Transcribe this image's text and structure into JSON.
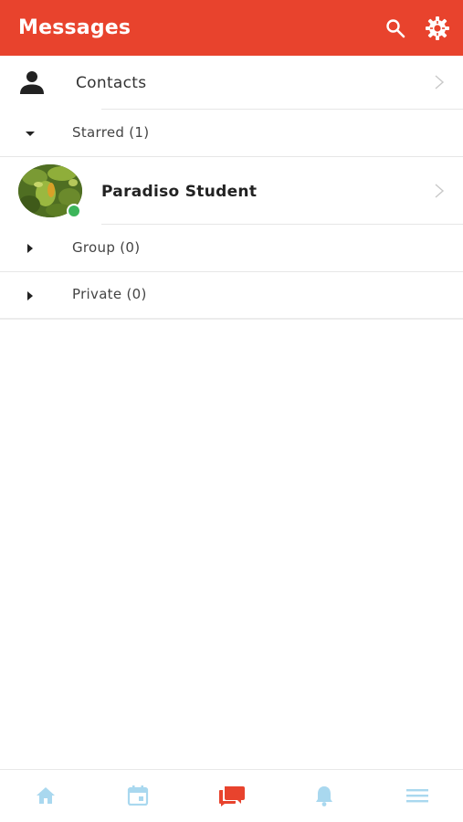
{
  "header": {
    "title": "Messages",
    "search_icon": "search-icon",
    "settings_icon": "gear-icon",
    "bg_color": "#e8432d"
  },
  "contacts": {
    "label": "Contacts",
    "icon": "person-icon"
  },
  "sections": {
    "starred": {
      "label": "Starred (1)",
      "expanded": true
    },
    "group": {
      "label": "Group (0)",
      "expanded": false
    },
    "private": {
      "label": "Private (0)",
      "expanded": false
    }
  },
  "starred_items": [
    {
      "name": "Paradiso Student",
      "status": "online",
      "status_color": "#3cb55a"
    }
  ],
  "bottom_nav": {
    "items": [
      {
        "icon": "home-icon",
        "active": false
      },
      {
        "icon": "calendar-icon",
        "active": false
      },
      {
        "icon": "chat-icon",
        "active": true
      },
      {
        "icon": "bell-icon",
        "active": false
      },
      {
        "icon": "menu-icon",
        "active": false
      }
    ],
    "active_color": "#e8432d",
    "inactive_color": "#a9d8ef"
  }
}
